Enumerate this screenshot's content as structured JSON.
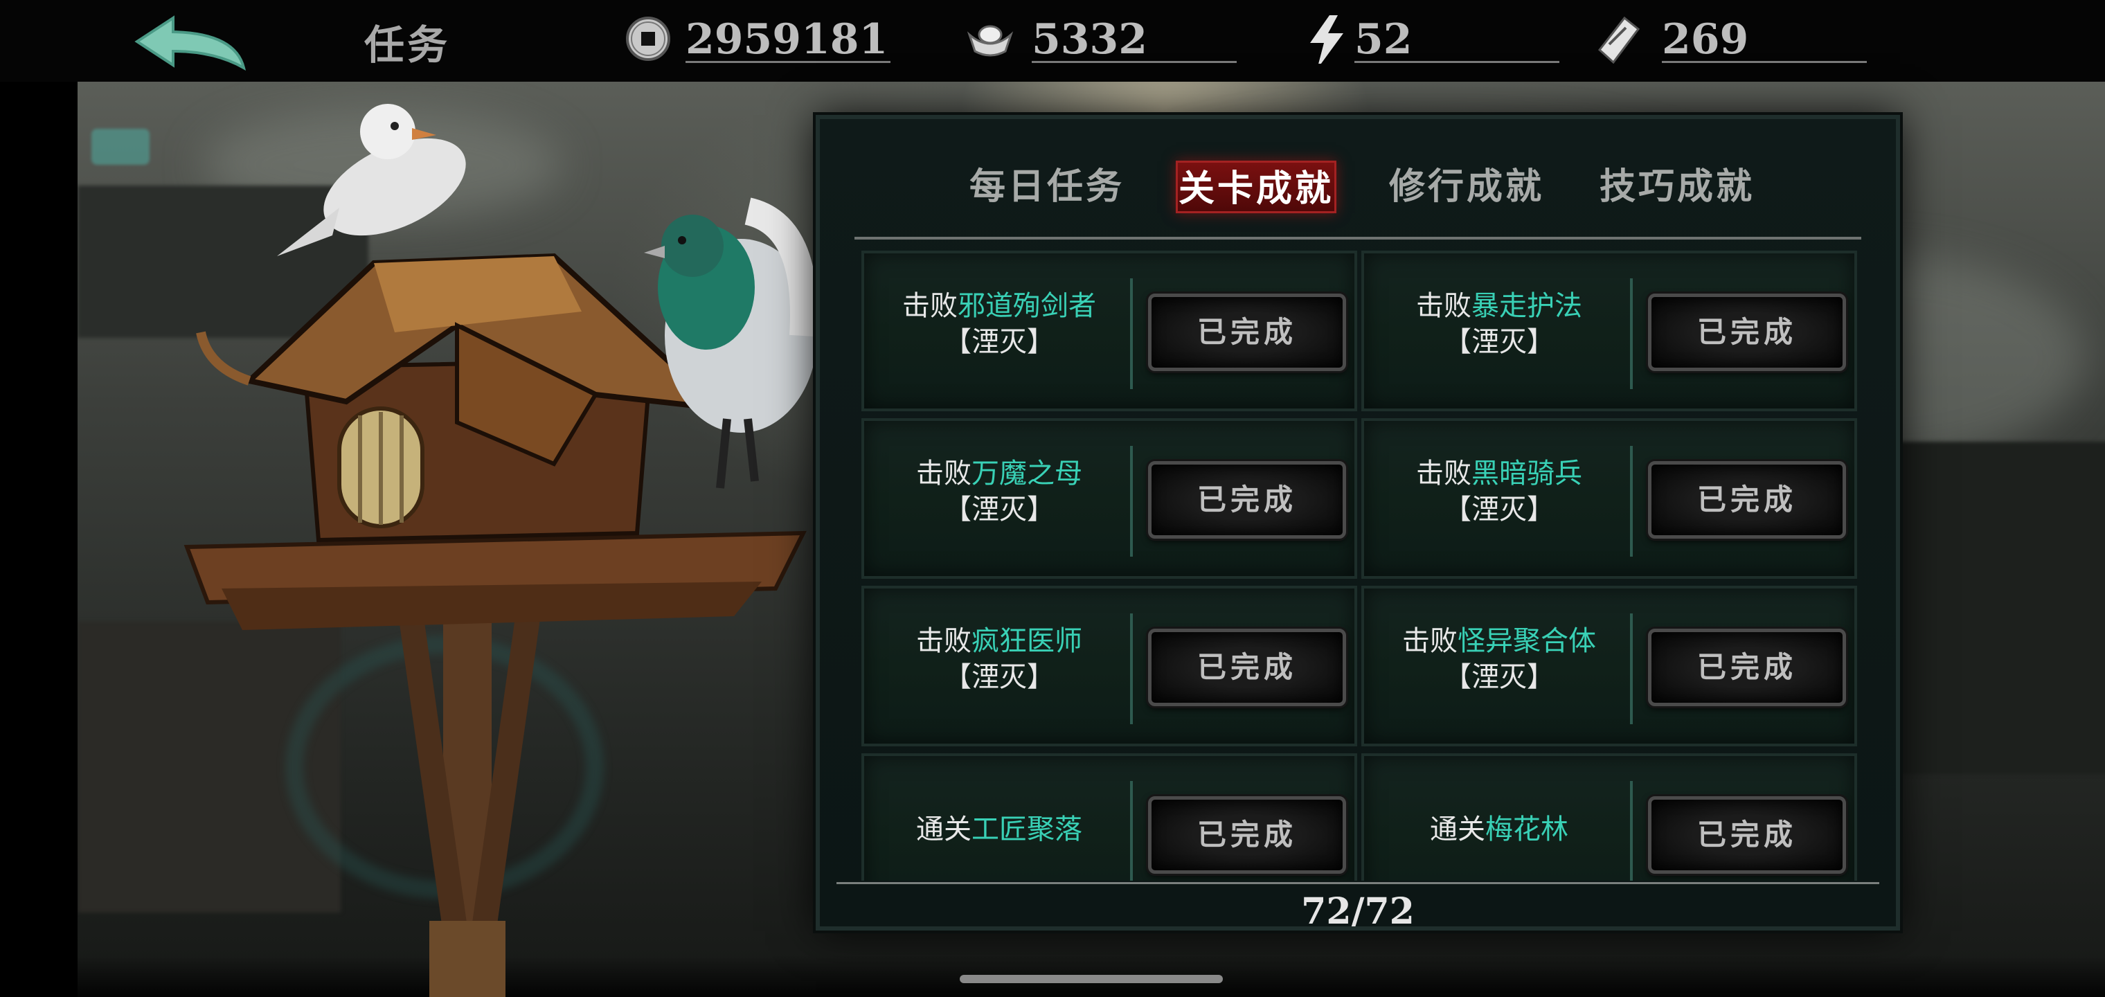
{
  "header": {
    "title": "任务",
    "resources": [
      {
        "icon": "coin-icon",
        "value": "2959181"
      },
      {
        "icon": "silver-ingot-icon",
        "value": "5332"
      },
      {
        "icon": "lightning-icon",
        "value": "52"
      },
      {
        "icon": "ticket-icon",
        "value": "269"
      }
    ]
  },
  "tabs": [
    {
      "label": "每日任务",
      "active": false
    },
    {
      "label": "关卡成就",
      "active": true
    },
    {
      "label": "修行成就",
      "active": false
    },
    {
      "label": "技巧成就",
      "active": false
    }
  ],
  "achievements": [
    {
      "prefix": "击败",
      "target": "邪道殉剑者",
      "suffix": "【湮灭】",
      "button": "已完成"
    },
    {
      "prefix": "击败",
      "target": "暴走护法",
      "suffix": "【湮灭】",
      "button": "已完成"
    },
    {
      "prefix": "击败",
      "target": "万魔之母",
      "suffix": "【湮灭】",
      "button": "已完成"
    },
    {
      "prefix": "击败",
      "target": "黑暗骑兵",
      "suffix": "【湮灭】",
      "button": "已完成"
    },
    {
      "prefix": "击败",
      "target": "疯狂医师",
      "suffix": "【湮灭】",
      "button": "已完成"
    },
    {
      "prefix": "击败",
      "target": "怪异聚合体",
      "suffix": "【湮灭】",
      "button": "已完成"
    },
    {
      "prefix": "通关",
      "target": "工匠聚落",
      "suffix": "",
      "button": "已完成"
    },
    {
      "prefix": "通关",
      "target": "梅花林",
      "suffix": "",
      "button": "已完成"
    }
  ],
  "counter": "72/72",
  "colors": {
    "highlight": "#39d1b6",
    "active_tab": "#7a1010",
    "panel": "#0f1a19"
  }
}
